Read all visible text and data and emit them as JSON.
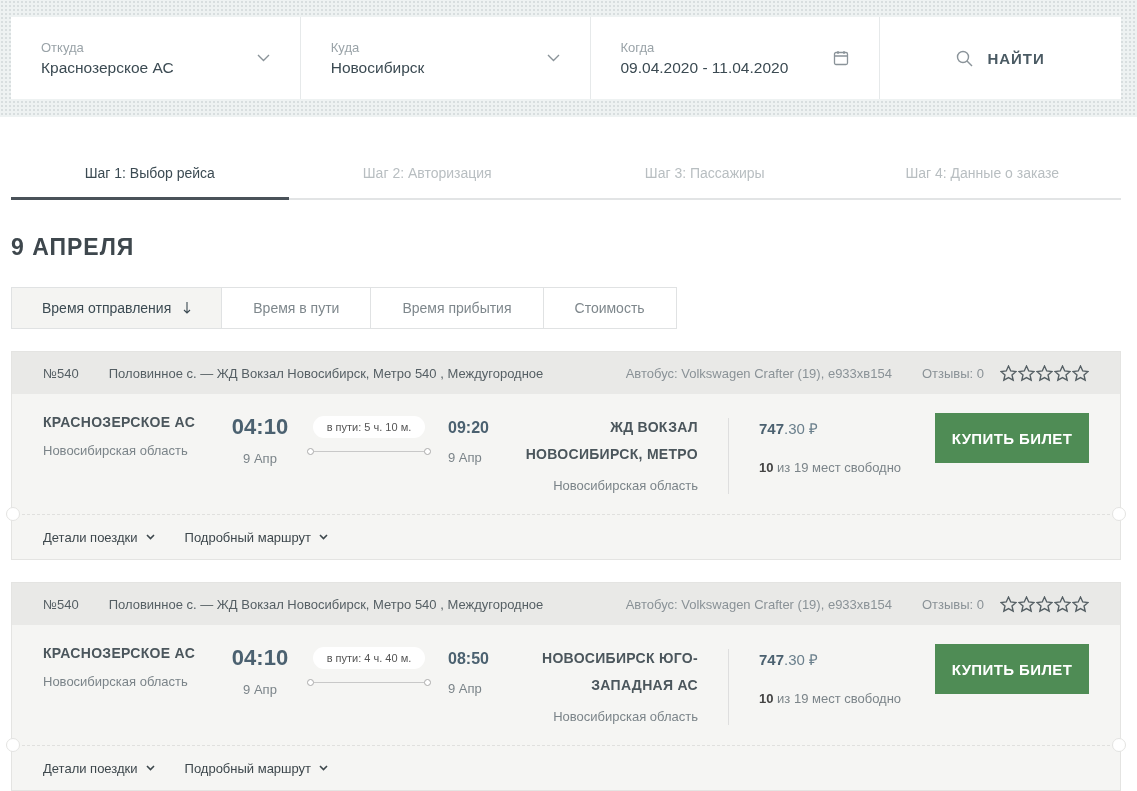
{
  "search": {
    "fields": [
      {
        "kind": "select",
        "label": "Откуда",
        "value": "Краснозерское АС"
      },
      {
        "kind": "select",
        "label": "Куда",
        "value": "Новосибирск"
      },
      {
        "kind": "date",
        "label": "Когда",
        "value": "09.04.2020 - 11.04.2020"
      }
    ],
    "button": "НАЙТИ"
  },
  "steps": [
    {
      "label": "Шаг 1: Выбор рейса",
      "selected": true
    },
    {
      "label": "Шаг 2: Авторизация",
      "selected": false
    },
    {
      "label": "Шаг 3: Пассажиры",
      "selected": false
    },
    {
      "label": "Шаг 4: Данные о заказе",
      "selected": false
    }
  ],
  "date_heading": "9 АПРЕЛЯ",
  "sort": [
    {
      "label": "Время отправления",
      "selected": true
    },
    {
      "label": "Время в пути",
      "selected": false
    },
    {
      "label": "Время прибытия",
      "selected": false
    },
    {
      "label": "Стоимость",
      "selected": false
    }
  ],
  "trips": [
    {
      "number": "№540",
      "route": "Половинное с. — ЖД Вокзал Новосибирск, Метро 540 , Междугородное",
      "bus": "Автобус: Volkswagen Crafter (19), е933хв154",
      "reviews": "Отзывы: 0",
      "stars": 0,
      "from_station": "КРАСНОЗЕРСКОЕ АС",
      "from_region": "Новосибирская область",
      "depart_time": "04:10",
      "depart_date": "9 Апр",
      "duration": "в пути: 5 ч. 10 м.",
      "arrive_time": "09:20",
      "arrive_date": "9 Апр",
      "to_station": "ЖД ВОКЗАЛ НОВОСИБИРСК, МЕТРО",
      "to_region": "Новосибирская область",
      "price": "**747**.30 ₽",
      "seats": "**10** из 19 мест свободно",
      "buy": "КУПИТЬ БИЛЕТ",
      "links": [
        "Детали поездки",
        "Подробный маршрут"
      ]
    },
    {
      "number": "№540",
      "route": "Половинное с. — ЖД Вокзал Новосибирск, Метро 540 , Междугородное",
      "bus": "Автобус: Volkswagen Crafter (19), е933хв154",
      "reviews": "Отзывы: 0",
      "stars": 0,
      "from_station": "КРАСНОЗЕРСКОЕ АС",
      "from_region": "Новосибирская область",
      "depart_time": "04:10",
      "depart_date": "9 Апр",
      "duration": "в пути: 4 ч. 40 м.",
      "arrive_time": "08:50",
      "arrive_date": "9 Апр",
      "to_station": "НОВОСИБИРСК ЮГО-ЗАПАДНАЯ АС",
      "to_region": "Новосибирская область",
      "price": "**747**.30 ₽",
      "seats": "**10** из 19 мест свободно",
      "buy": "КУПИТЬ БИЛЕТ",
      "links": [
        "Детали поездки",
        "Подробный маршрут"
      ]
    }
  ]
}
